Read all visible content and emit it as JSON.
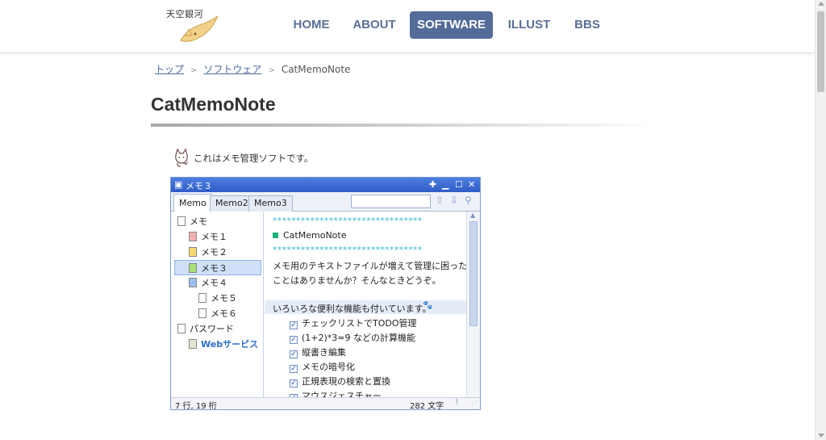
{
  "site": {
    "logo_text": "天空銀河"
  },
  "nav": {
    "items": [
      "HOME",
      "ABOUT",
      "SOFTWARE",
      "ILLUST",
      "BBS"
    ],
    "active": "SOFTWARE"
  },
  "breadcrumb": {
    "top": "トップ",
    "software": "ソフトウェア",
    "current": "CatMemoNote"
  },
  "page": {
    "title": "CatMemoNote",
    "intro": "これはメモ管理ソフトです。"
  },
  "app": {
    "window_title": "メモ３",
    "tabs": [
      "Memo",
      "Memo2",
      "Memo3"
    ],
    "search_value": "",
    "tree": [
      {
        "label": "メモ",
        "level": 0,
        "icon_color": "#ffffff"
      },
      {
        "label": "メモ１",
        "level": 1,
        "icon_color": "#f4b0b0"
      },
      {
        "label": "メモ２",
        "level": 1,
        "icon_color": "#f7d86a"
      },
      {
        "label": "メモ３",
        "level": 1,
        "icon_color": "#a8e07a",
        "selected": true
      },
      {
        "label": "メモ４",
        "level": 1,
        "icon_color": "#9cc0ef"
      },
      {
        "label": "メモ５",
        "level": 2,
        "icon_color": "#ffffff"
      },
      {
        "label": "メモ６",
        "level": 2,
        "icon_color": "#ffffff"
      },
      {
        "label": "パスワード",
        "level": 0,
        "icon_color": "#ffffff"
      },
      {
        "label": "Webサービス",
        "level": 1,
        "icon_color": "#e8e2d4",
        "link": true
      }
    ],
    "content": {
      "dots": "********************************",
      "heading": "CatMemoNote",
      "para1": "メモ用のテキストファイルが増えて管理に困った",
      "para2": "ことはありませんか？そんなときどうぞ。",
      "features_head": "いろいろな便利な機能も付いています。",
      "features": [
        "チェックリストでTODO管理",
        "(1+2)*3=9 などの計算機能",
        "縦書き編集",
        "メモの暗号化",
        "正規表現の検索と置換",
        "マウスジェスチャー"
      ]
    },
    "status_left": "7 行, 19 桁",
    "status_right": "282 文字"
  },
  "colors": {
    "nav_active_bg": "#536c9a",
    "nav_text": "#5a6f97",
    "app_titlebar": "#3b68d2"
  }
}
